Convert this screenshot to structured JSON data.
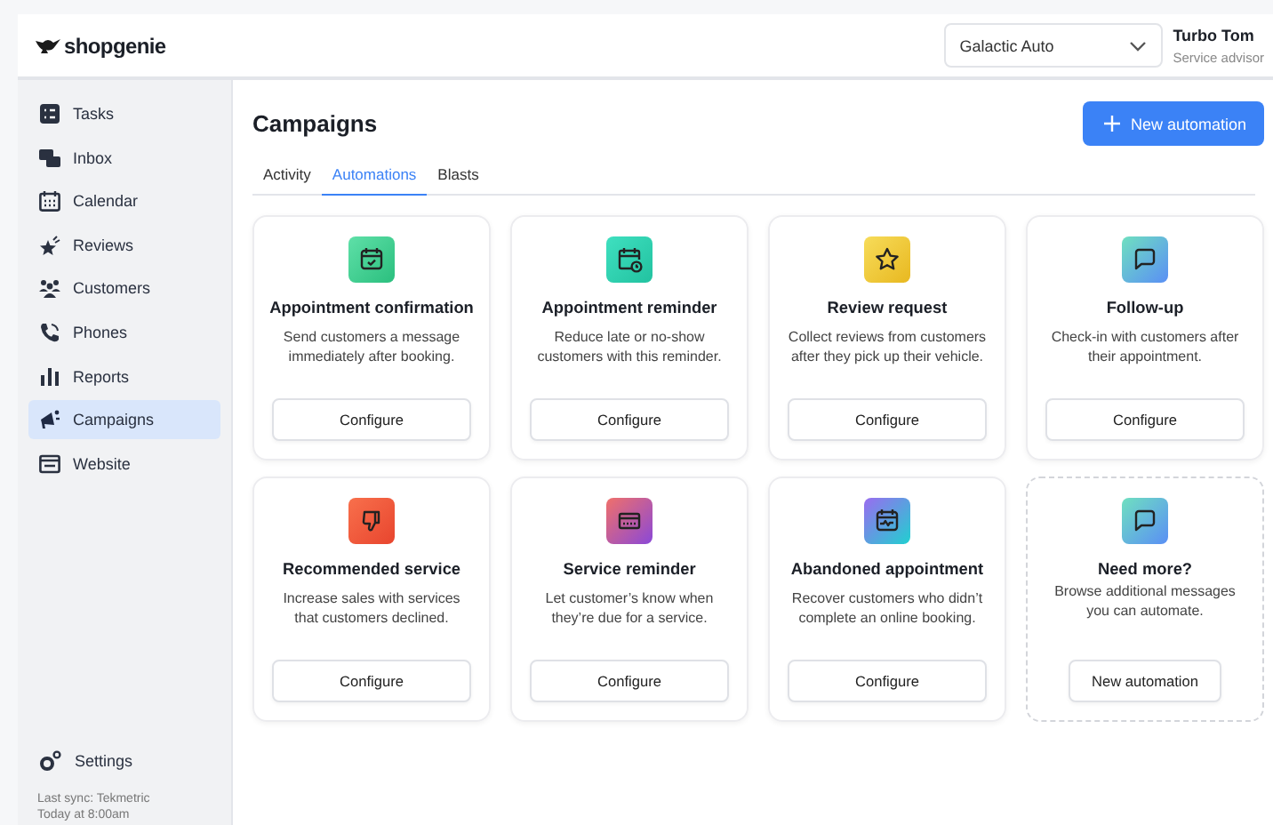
{
  "brand": "shopgenie",
  "shop_select": {
    "value": "Galactic Auto"
  },
  "user": {
    "name": "Turbo Tom",
    "role": "Service advisor"
  },
  "sidebar": {
    "items": [
      {
        "label": "Tasks",
        "selected": false
      },
      {
        "label": "Inbox",
        "selected": false
      },
      {
        "label": "Calendar",
        "selected": false
      },
      {
        "label": "Reviews",
        "selected": false
      },
      {
        "label": "Customers",
        "selected": false
      },
      {
        "label": "Phones",
        "selected": false
      },
      {
        "label": "Reports",
        "selected": false
      },
      {
        "label": "Campaigns",
        "selected": true
      },
      {
        "label": "Website",
        "selected": false
      }
    ],
    "settings": "Settings",
    "sync": [
      "Last sync: Tekmetric",
      "Today at 8:00am"
    ]
  },
  "page": {
    "title": "Campaigns",
    "action": "New automation"
  },
  "tabs": [
    {
      "label": "Activity",
      "selected": false
    },
    {
      "label": "Automations",
      "selected": true
    },
    {
      "label": "Blasts",
      "selected": false
    }
  ],
  "cards": [
    {
      "kind": "automation",
      "title": "Appointment confirmation",
      "text": "Send customers a message immediately after booking.",
      "button": "Configure"
    },
    {
      "kind": "automation",
      "title": "Appointment reminder",
      "text": "Reduce late or no-show customers with this reminder.",
      "button": "Configure"
    },
    {
      "kind": "automation",
      "title": "Review request",
      "text": "Collect reviews from customers after they pick up their vehicle.",
      "button": "Configure"
    },
    {
      "kind": "automation",
      "title": "Follow-up",
      "text": "Check-in with customers after their appointment.",
      "button": "Configure"
    },
    {
      "kind": "automation",
      "title": "Recommended service",
      "text": "Increase sales with services that customers declined.",
      "button": "Configure"
    },
    {
      "kind": "automation",
      "title": "Service reminder",
      "text": "Let customer’s know when they’re due for a service.",
      "button": "Configure"
    },
    {
      "kind": "automation",
      "title": "Abandoned appointment",
      "text": "Recover customers who didn’t complete an online booking.",
      "button": "Configure"
    },
    {
      "kind": "more",
      "title": "Need more?",
      "text": "Browse additional messages you can automate.",
      "button": "New automation"
    }
  ]
}
